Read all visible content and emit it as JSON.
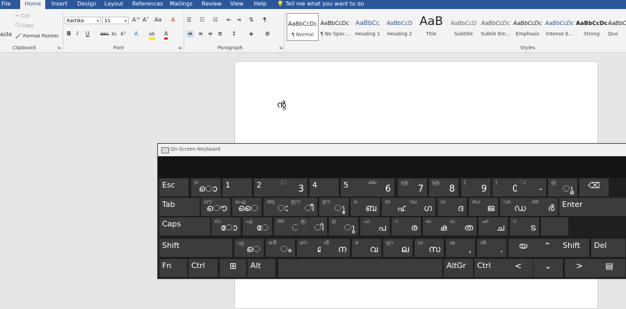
{
  "tabs": [
    "File",
    "Home",
    "Insert",
    "Design",
    "Layout",
    "References",
    "Mailings",
    "Review",
    "View",
    "Help"
  ],
  "tell_me": "Tell me what you want to do",
  "clipboard": {
    "paste": "aste",
    "cut": "Cut",
    "copy": "Copy",
    "format_painter": "Format Painter",
    "label": "Clipboard"
  },
  "font": {
    "name": "Kartika",
    "size": "11",
    "label": "Font",
    "bold": "B",
    "italic": "I",
    "underline": "U",
    "strike": "abc",
    "sub": "x₂",
    "sup": "x²",
    "grow": "A^",
    "shrink": "A˅",
    "case": "Aa",
    "clear": "A",
    "effects": "A",
    "highlight": "ab",
    "color": "A"
  },
  "paragraph": {
    "label": "Paragraph",
    "pilcrow": "¶"
  },
  "styles": {
    "label": "Styles",
    "items": [
      {
        "preview": "AaBbCcDc",
        "name": "¶ Normal"
      },
      {
        "preview": "AaBbCcDc",
        "name": "¶ No Spac..."
      },
      {
        "preview": "AaBbCc",
        "name": "Heading 1"
      },
      {
        "preview": "AaBbCcD",
        "name": "Heading 2"
      },
      {
        "preview": "AaB",
        "name": "Title"
      },
      {
        "preview": "AaBbCcD",
        "name": "Subtitle"
      },
      {
        "preview": "AaBbCcDc",
        "name": "Subtle Em..."
      },
      {
        "preview": "AaBbCcDc",
        "name": "Emphasis"
      },
      {
        "preview": "AaBbCcDc",
        "name": "Intense E..."
      },
      {
        "preview": "AaBbCcDc",
        "name": "Strong"
      },
      {
        "preview": "AaBbCcD",
        "name": "Quo"
      }
    ]
  },
  "document": {
    "text": "ന്റ"
  },
  "osk": {
    "title": "On-Screen Keyboard",
    "rows": [
      [
        {
          "l": "Esc"
        },
        {
          "s": "ഒ",
          "m": "ൊ"
        },
        {
          "l": "1"
        },
        {
          "l": "2"
        },
        {
          "s": "്ര",
          "m": "3"
        },
        {
          "l": "4"
        },
        {
          "l": "5"
        },
        {
          "s": "ക്ഷ",
          "m": "6"
        },
        {
          "s": "ശ്ര",
          "m": "7"
        },
        {
          "s": "ശ്ര",
          "m": "8"
        },
        {
          "s": "(",
          "m": "9"
        },
        {
          "s": ")",
          "m": "0"
        },
        {
          "s": "ഃ",
          "m": "-"
        },
        {
          "s": "ഋ",
          "m": "ൃ"
        },
        {
          "c": "⌫"
        }
      ],
      [
        {
          "l": "Tab"
        },
        {
          "s": "ഔ",
          "m": "ൌ"
        },
        {
          "s": "ഐ",
          "m": "ൈ"
        },
        {
          "s": "ആ",
          "m": "ാ"
        },
        {
          "s": "ഈ",
          "m": "ീ"
        },
        {
          "s": "ഊ",
          "m": "ൂ"
        },
        {
          "s": "ഭ",
          "m": "ബ"
        },
        {
          "s": "ങ",
          "m": "ഹ"
        },
        {
          "s": "ഘ",
          "m": "ഗ"
        },
        {
          "s": "ധ",
          "m": "ദ"
        },
        {
          "s": "ഝ",
          "m": "ജ"
        },
        {
          "s": "ഢ",
          "m": "ഡ"
        },
        {
          "s": "ഞ",
          "m": "ർ"
        },
        {
          "l": "Enter"
        }
      ],
      [
        {
          "l": "Caps"
        },
        {
          "s": "ഓ",
          "m": "ോ"
        },
        {
          "s": "ഏ",
          "m": "േ"
        },
        {
          "s": "അ",
          "m": "്"
        },
        {
          "s": "ഇ",
          "m": "ി"
        },
        {
          "s": "ഉ",
          "m": "ു"
        },
        {
          "s": "ഫ",
          "m": "പ"
        },
        {
          "s": "റ",
          "m": "ര"
        },
        {
          "s": "ഖ",
          "m": "ക"
        },
        {
          "s": "ഥ",
          "m": "ത"
        },
        {
          "s": "ഛ",
          "m": "ച"
        },
        {
          "s": "ഠ",
          "m": "ട"
        },
        {
          "l": ""
        }
      ],
      [
        {
          "l": "Shift"
        },
        {
          "s": "എ",
          "m": "െ"
        },
        {
          "s": "ൺ",
          "m": "ം"
        },
        {
          "s": "ണ",
          "m": "മ"
        },
        {
          "s": "ൻ",
          "m": "ന"
        },
        {
          "s": "ഴ",
          "m": "വ"
        },
        {
          "s": "ളാ",
          "m": "ല"
        },
        {
          "s": "ശ",
          "m": "സ"
        },
        {
          "s": "ഷ",
          "m": ","
        },
        {
          "s": "ൽ",
          "m": "."
        },
        {
          "c": "യ"
        },
        {
          "c": "⌃"
        },
        {
          "l": "Shift"
        },
        {
          "l": "Del"
        }
      ],
      [
        {
          "l": "Fn"
        },
        {
          "l": "Ctrl"
        },
        {
          "c": "⊞"
        },
        {
          "l": "Alt"
        },
        {
          "l": ""
        },
        {
          "l": "AltGr"
        },
        {
          "l": "Ctrl"
        },
        {
          "c": "<"
        },
        {
          "c": "⌄"
        },
        {
          "c": ">"
        },
        {
          "c": "▤"
        }
      ]
    ]
  }
}
